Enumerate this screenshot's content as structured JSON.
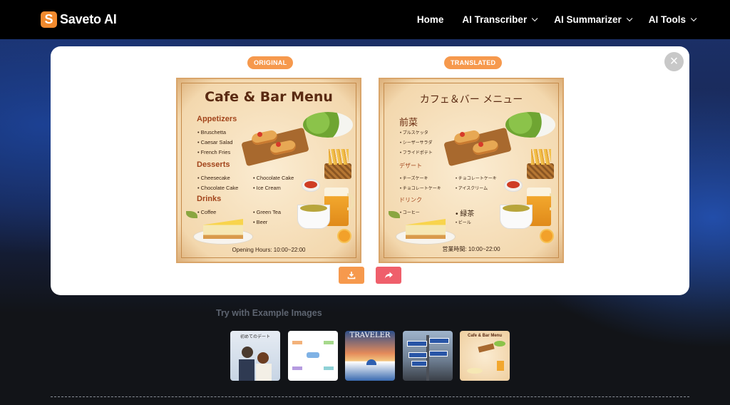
{
  "header": {
    "logo_letter": "S",
    "logo_text": "Saveto AI",
    "nav": [
      {
        "label": "Home",
        "has_dropdown": false
      },
      {
        "label": "AI Transcriber",
        "has_dropdown": true
      },
      {
        "label": "AI Summarizer",
        "has_dropdown": true
      },
      {
        "label": "AI Tools",
        "has_dropdown": true
      }
    ]
  },
  "comparison": {
    "original_label": "ORIGINAL",
    "translated_label": "TRANSLATED",
    "close_symbol": "×",
    "original_menu": {
      "title": "Cafe & Bar Menu",
      "appetizers": "Appetizers",
      "appetizer_items": [
        "Bruschetta",
        "Caesar Salad",
        "French Fries"
      ],
      "desserts": "Desserts",
      "dessert_items": [
        "Cheesecake",
        "Chocolate Cake",
        "Chocolate Cake",
        "Ice Cream"
      ],
      "drinks": "Drinks",
      "drink_items": [
        "Coffee",
        "Green Tea",
        "Beer"
      ],
      "footer": "Opening Hours: 10:00~22:00"
    },
    "translated_menu": {
      "title": "カフェ＆バー メニュー",
      "appetizers": "前菜",
      "appetizer_items": [
        "ブルスケッタ",
        "シーザーサラダ",
        "フライドポテト"
      ],
      "desserts": "デザート",
      "dessert_items": [
        "チーズケーキ",
        "チョコレートケーキ",
        "チョコレートケーキ",
        "アイスクリーム"
      ],
      "drinks": "ドリンク",
      "drink_items": [
        "コーヒー",
        "緑茶",
        "ビール"
      ],
      "footer": "営業時間: 10:00~22:00"
    },
    "download_icon": "download-icon",
    "share_icon": "share-icon",
    "colors": {
      "pill": "#f6994d",
      "download_btn": "#f6994d",
      "share_btn": "#ef5f6b"
    }
  },
  "examples": {
    "title": "Try with Example Images",
    "items": [
      {
        "name": "manga-comic",
        "caption": "初めてのデート"
      },
      {
        "name": "mind-map",
        "caption": ""
      },
      {
        "name": "travel-magazine",
        "caption": "TRAVELER"
      },
      {
        "name": "street-signs",
        "caption": ""
      },
      {
        "name": "cafe-menu",
        "caption": "Cafe & Bar Menu"
      }
    ]
  }
}
